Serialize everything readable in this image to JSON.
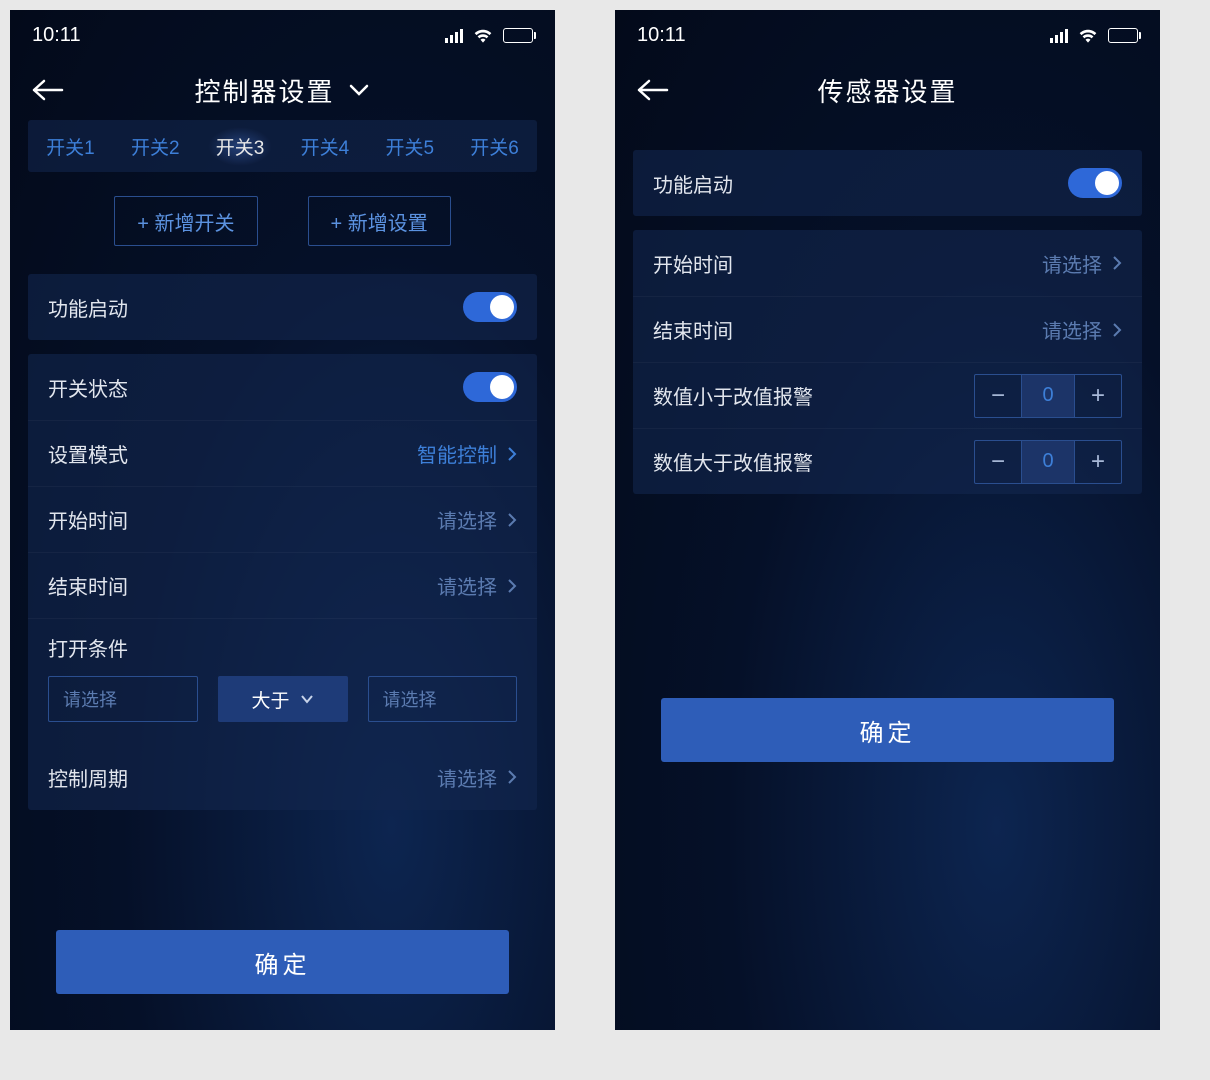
{
  "status": {
    "time": "10:11"
  },
  "left": {
    "title": "控制器设置",
    "tabs": [
      "开关1",
      "开关2",
      "开关3",
      "开关4",
      "开关5",
      "开关6"
    ],
    "active_tab_index": 2,
    "add_switch": "+ 新增开关",
    "add_setting": "+ 新增设置",
    "enable_label": "功能启动",
    "switch_state_label": "开关状态",
    "mode_label": "设置模式",
    "mode_value": "智能控制",
    "start_time_label": "开始时间",
    "end_time_label": "结束时间",
    "please_select": "请选择",
    "open_condition_label": "打开条件",
    "comparator": "大于",
    "cycle_label": "控制周期",
    "confirm": "确定"
  },
  "right": {
    "title": "传感器设置",
    "enable_label": "功能启动",
    "start_time_label": "开始时间",
    "end_time_label": "结束时间",
    "please_select": "请选择",
    "low_alarm_label": "数值小于改值报警",
    "high_alarm_label": "数值大于改值报警",
    "low_value": "0",
    "high_value": "0",
    "confirm": "确定"
  }
}
